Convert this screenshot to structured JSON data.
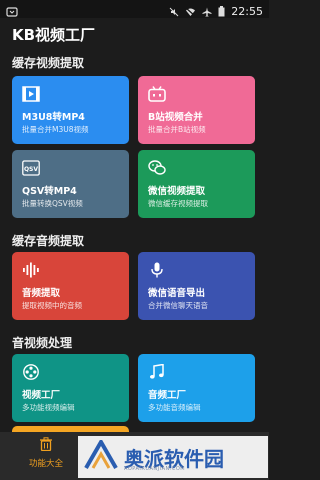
{
  "status": {
    "time": "22:55"
  },
  "app": {
    "title": "KB视频工厂"
  },
  "sections": [
    {
      "title": "缓存视频提取",
      "cards": [
        {
          "title": "M3U8转MP4",
          "sub": "批量合并M3U8视频",
          "icon": "video-merge-icon",
          "color": "#2b8df0"
        },
        {
          "title": "B站视频合并",
          "sub": "批量合并B站视频",
          "icon": "bilibili-icon",
          "color": "#f06a96"
        },
        {
          "title": "QSV转MP4",
          "sub": "批量转换QSV视频",
          "icon": "qsv-icon",
          "color": "#4e6e86"
        },
        {
          "title": "微信视频提取",
          "sub": "微信缓存视频提取",
          "icon": "wechat-icon",
          "color": "#1c9a5a"
        }
      ]
    },
    {
      "title": "缓存音频提取",
      "cards": [
        {
          "title": "音频提取",
          "sub": "提取视频中的音频",
          "icon": "audio-wave-icon",
          "color": "#d8453a"
        },
        {
          "title": "微信语音导出",
          "sub": "合并微信聊天语音",
          "icon": "microphone-icon",
          "color": "#3b53b0"
        }
      ]
    },
    {
      "title": "音视频处理",
      "cards": [
        {
          "title": "视频工厂",
          "sub": "多功能视频编辑",
          "icon": "film-reel-icon",
          "color": "#0f9486"
        },
        {
          "title": "音频工厂",
          "sub": "多功能音频编辑",
          "icon": "music-note-icon",
          "color": "#1da0ea"
        }
      ]
    }
  ],
  "nav": {
    "label": "功能大全"
  },
  "watermark": {
    "text": "奥派软件园",
    "sub": "AOPAIRUANJIAN.COM"
  }
}
